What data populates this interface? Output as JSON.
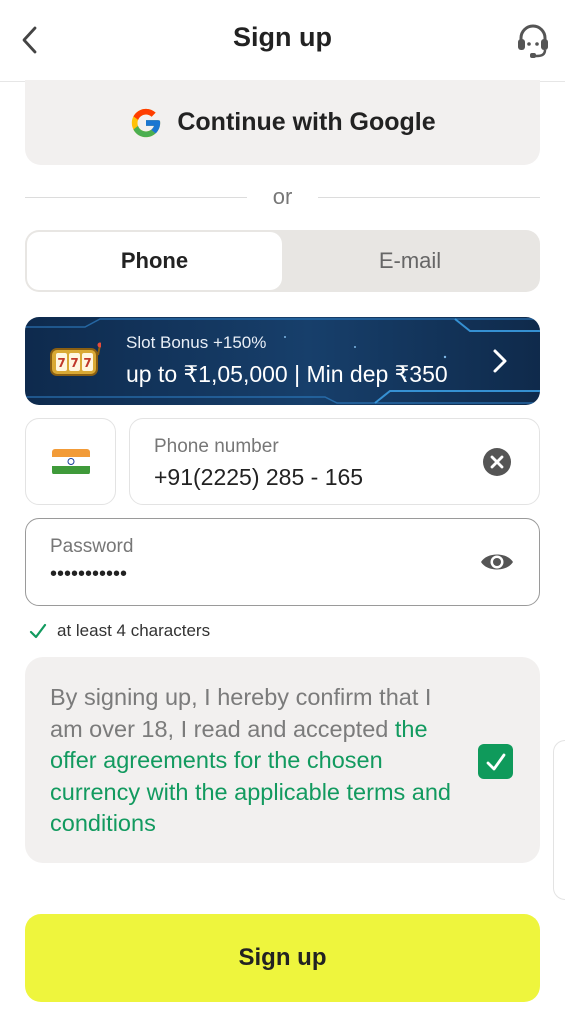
{
  "header": {
    "title": "Sign up",
    "back_icon": "chevron-left-icon",
    "support_icon": "headset-icon"
  },
  "google": {
    "label": "Continue with Google",
    "icon": "google-icon"
  },
  "divider": {
    "text": "or"
  },
  "tabs": [
    {
      "label": "Phone",
      "active": true
    },
    {
      "label": "E-mail",
      "active": false
    }
  ],
  "banner": {
    "line1": "Slot Bonus +150%",
    "line2": "up to ₹1,05,000 | Min dep ₹350",
    "icon": "slot-machine-icon"
  },
  "country": {
    "flag": "india-flag-icon"
  },
  "phone": {
    "label": "Phone number",
    "value": "+91(2225) 285 - 165"
  },
  "password": {
    "label": "Password",
    "value": "•••••••••••"
  },
  "hint": {
    "text": "at least 4 characters"
  },
  "agreement": {
    "prefix": "By signing up, I hereby confirm that I am over 18, I read and accepted ",
    "link": "the offer agreements for the chosen currency with the applicable terms and conditions",
    "checked": true
  },
  "signup_button": {
    "label": "Sign up"
  },
  "colors": {
    "accent_green": "#129a5f",
    "signup_yellow": "#eef53d",
    "banner_navy": "#173f6b"
  }
}
